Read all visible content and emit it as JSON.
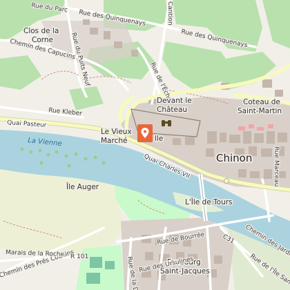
{
  "map": {
    "colors": {
      "land": "#f2efe9",
      "water": "#aad3df",
      "vineyard": "#aedfa3",
      "park": "#c8facc",
      "town": "#d9d0c9",
      "building": "#c4b6ab",
      "primary_road": "#f7fabf",
      "road": "#ffffff",
      "marker": "#e8673a"
    },
    "labels": {
      "clos_corne": "Clos de la Corne",
      "rue_du_parc": "Rue du Parc",
      "rue_quinquenays_1": "Rue des Quinquenays",
      "rue_quinquenays_2": "Rue des Quinquenays",
      "chemin_capucins": "Chemin des Capucins",
      "rue_puits_neuf": "Rue du Puits Neuf",
      "rue_echo": "Rue de l'Écho",
      "cantion": "Cantion",
      "rue_kleber": "Rue Kleber",
      "quai_pasteur": "Quai Pasteur",
      "vieux_marche": "Le Vieux Marché",
      "devant_chateau": "Devant le Château",
      "coteau_st_martin": "Coteau de Saint-Martin",
      "la_vienne": "La Vienne",
      "quai_charles_vii": "Quai Charles VII",
      "chinon": "Chinon",
      "rue_marceau": "Rue Marceau",
      "ile_auger": "Île Auger",
      "ile_de_tours": "L'Île de Tours",
      "chemin_des_jardins": "Chemin des Jardins",
      "chemin_pres_cousins": "Chemin des Prés Cousins",
      "marais_roche": "Marais de la Roche",
      "r101": "R 101",
      "rue_bourree": "Rue de Bourrée",
      "faubourg": "Faubourg Saint-Jacques",
      "rue_ursulines": "Rue des Ursulines",
      "rue_ile_sane": "Rue de l'Île Sane",
      "c31": "C31",
      "ville_fragment": "lle"
    },
    "icons": {
      "marker": "map-pin-marker",
      "castle": "binoculars-viewpoint-icon"
    }
  }
}
